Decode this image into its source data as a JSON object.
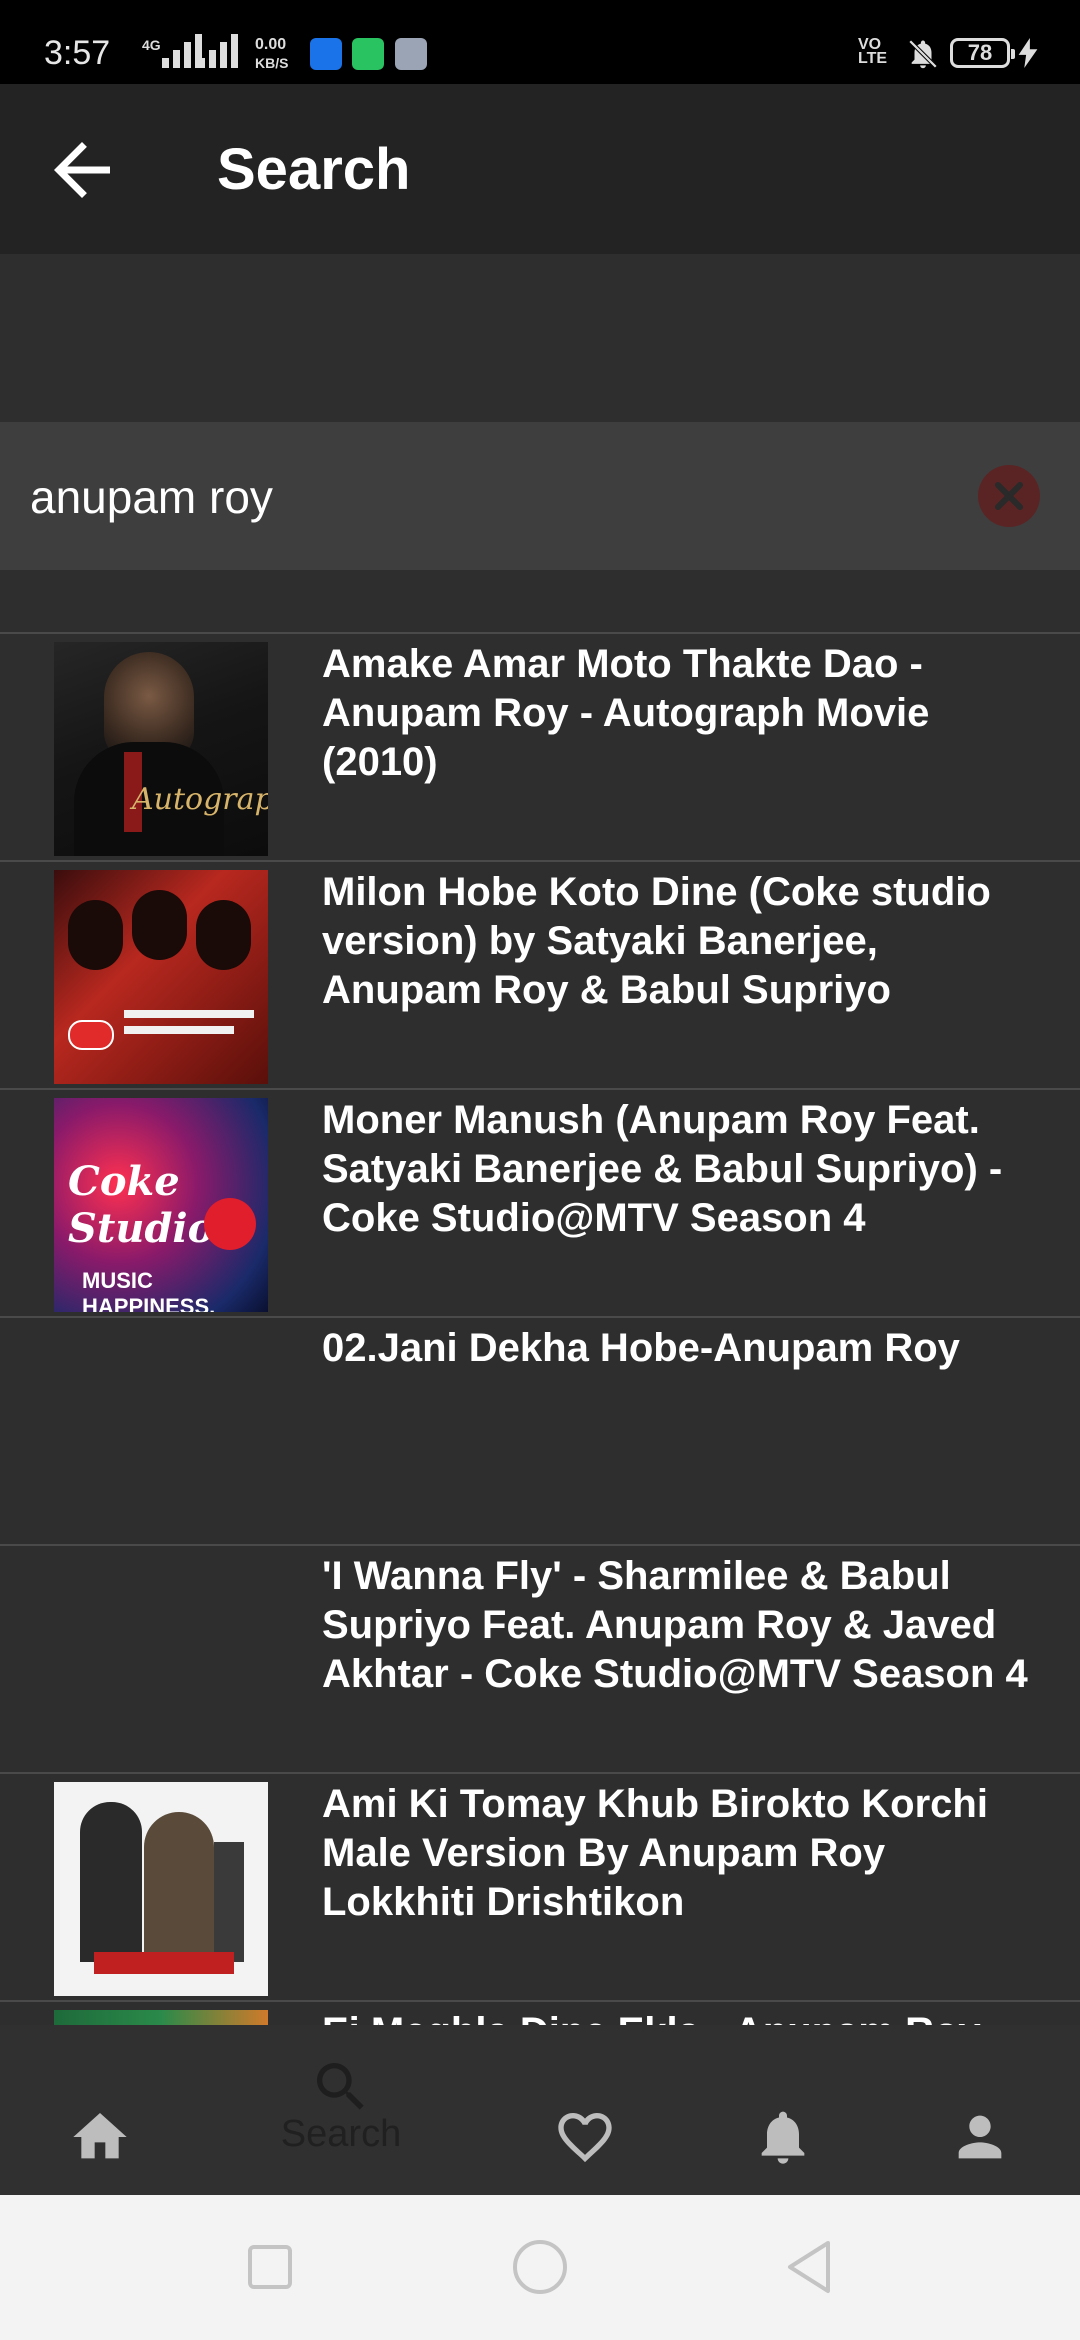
{
  "status_bar": {
    "time": "3:57",
    "network_gen": "4G",
    "speed_value": "0.00",
    "speed_unit": "KB/S",
    "volte_line1": "VO",
    "volte_line2": "LTE",
    "battery_level": "78",
    "icons": [
      "signal-icon",
      "signal-icon",
      "app-notification-icon",
      "chat-notification-icon",
      "app-store-icon",
      "volte-icon",
      "mute-bell-icon",
      "battery-icon",
      "charging-icon"
    ]
  },
  "app_bar": {
    "title": "Search",
    "back_icon": "arrow-left-icon"
  },
  "search": {
    "value": "anupam roy",
    "placeholder": "",
    "clear_icon": "close-circle-icon"
  },
  "results": [
    {
      "title": "Amake Amar Moto Thakte  Dao - Anupam Roy - Autograph Movie (2010)",
      "thumb": "autograph"
    },
    {
      "title": "Milon Hobe Koto Dine (Coke studio version) by Satyaki Banerjee, Anupam Roy & Babul Supriyo",
      "thumb": "coke-happiness"
    },
    {
      "title": "Moner Manush (Anupam Roy Feat. Satyaki Banerjee & Babul Supriyo) - Coke Studio@MTV Season 4",
      "thumb": "coke-studio"
    },
    {
      "title": "02.Jani Dekha Hobe-Anupam Roy",
      "thumb": "none"
    },
    {
      "title": "'I Wanna Fly' - Sharmilee & Babul Supriyo Feat. Anupam Roy & Javed Akhtar - Coke Studio@MTV Season 4",
      "thumb": "none"
    },
    {
      "title": "Ami Ki Tomay Khub Birokto Korchi Male Version By Anupam Roy Lokkhiti   Drishtikon",
      "thumb": "drishtikon"
    },
    {
      "title": "Ei Meghla Dine Ekla - Anupam Roy",
      "thumb": "partial"
    }
  ],
  "thumb_text": {
    "autograph": "Autograph.",
    "coke": "Coke Studio",
    "music": "MUSIC HAPPINESS."
  },
  "bottom_nav": {
    "items": [
      {
        "icon": "home-icon",
        "label": ""
      },
      {
        "icon": "search-icon",
        "label": "Search"
      },
      {
        "icon": "heart-icon",
        "label": ""
      },
      {
        "icon": "bell-icon",
        "label": ""
      },
      {
        "icon": "person-icon",
        "label": ""
      }
    ]
  },
  "system_nav": {
    "icons": [
      "recents-square-icon",
      "home-circle-icon",
      "back-triangle-icon"
    ]
  },
  "colors": {
    "background": "#2e2e2e",
    "app_bar": "#232323",
    "search_box": "#3e3e3e",
    "divider": "#4a4a4a",
    "clear_button": "#5a2424",
    "bottom_nav": "#303030",
    "system_nav": "#f3f3f3"
  }
}
